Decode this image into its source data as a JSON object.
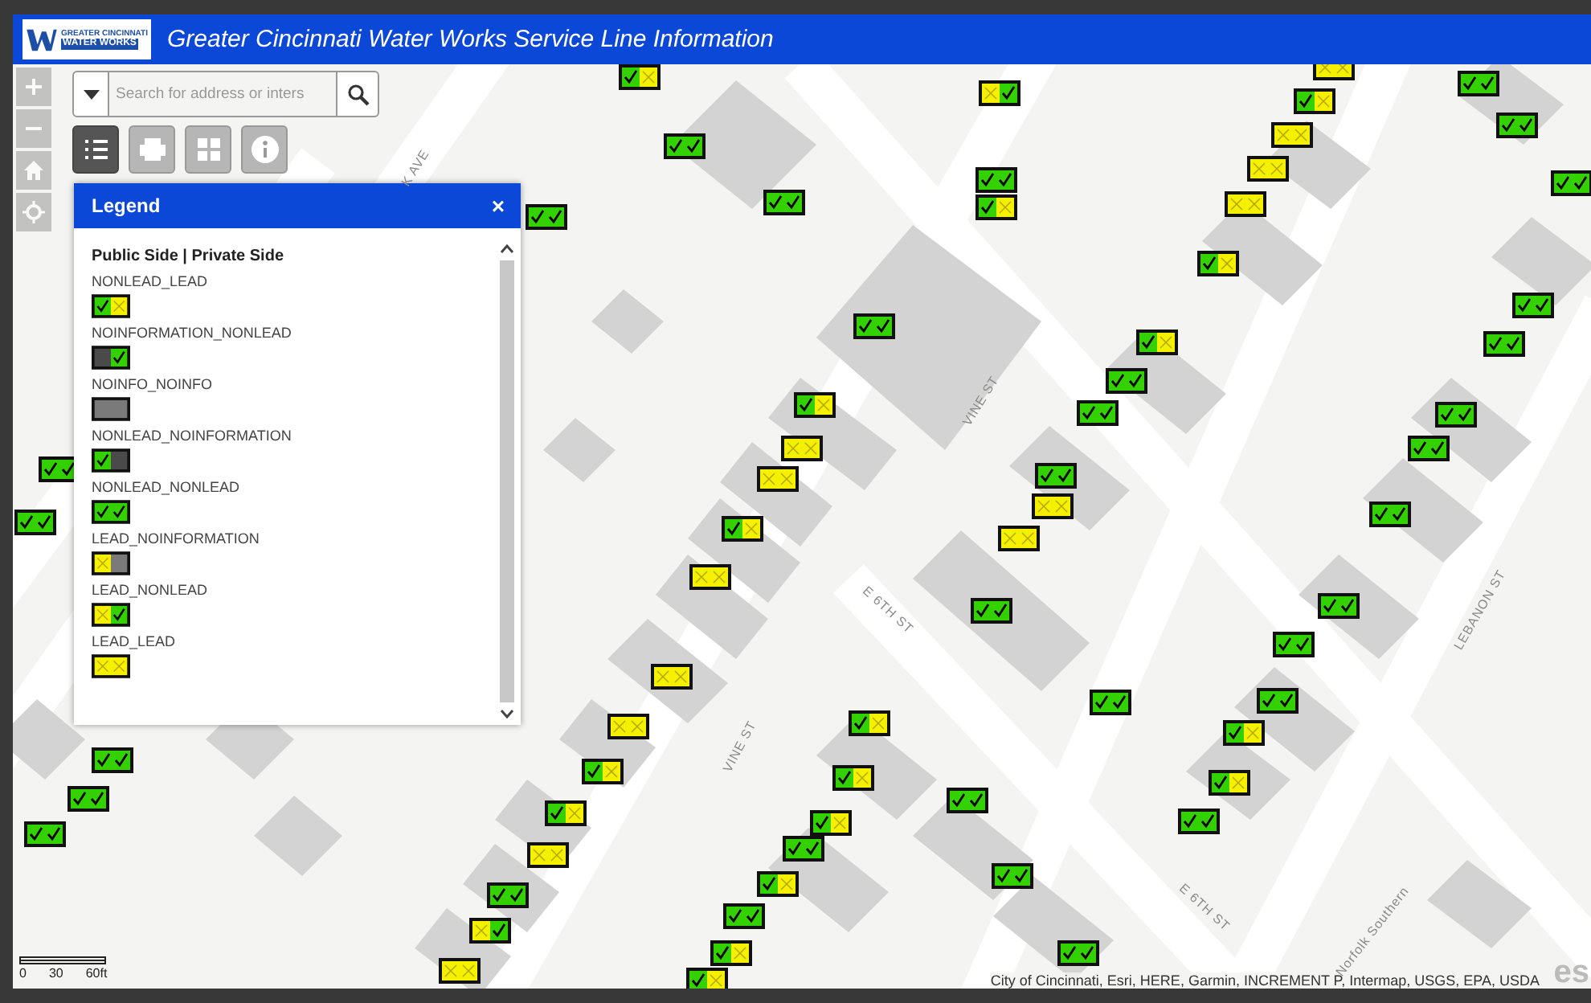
{
  "header": {
    "logo": {
      "line_1": "GREATER CINCINNATI",
      "line_2": "WATER WORKS"
    },
    "title": "Greater Cincinnati Water Works Service Line Information"
  },
  "search": {
    "placeholder": "Search for address or inters"
  },
  "toolbar": [
    {
      "kind": "legend",
      "selected": true
    },
    {
      "kind": "print",
      "selected": false
    },
    {
      "kind": "basemap",
      "selected": false
    },
    {
      "kind": "info",
      "selected": false
    }
  ],
  "legend": {
    "title": "Legend",
    "close": "×",
    "heading": "Public Side | Private Side",
    "items": [
      {
        "label": "NONLEAD_LEAD",
        "sides": [
          {
            "kind": "nonlead"
          },
          {
            "kind": "lead"
          }
        ]
      },
      {
        "label": "NOINFORMATION_NONLEAD",
        "sides": [
          {
            "kind": "noinfodark"
          },
          {
            "kind": "nonlead"
          }
        ]
      },
      {
        "label": "NOINFO_NOINFO",
        "sides": [
          {
            "kind": "noinfo"
          },
          {
            "kind": "noinfo"
          }
        ]
      },
      {
        "label": "NONLEAD_NOINFORMATION",
        "sides": [
          {
            "kind": "nonlead"
          },
          {
            "kind": "noinfodark"
          }
        ]
      },
      {
        "label": "NONLEAD_NONLEAD",
        "sides": [
          {
            "kind": "nonlead"
          },
          {
            "kind": "nonlead"
          }
        ]
      },
      {
        "label": "LEAD_NOINFORMATION",
        "sides": [
          {
            "kind": "lead"
          },
          {
            "kind": "noinfo"
          }
        ]
      },
      {
        "label": "LEAD_NONLEAD",
        "sides": [
          {
            "kind": "lead"
          },
          {
            "kind": "nonlead"
          }
        ]
      },
      {
        "label": "LEAD_LEAD",
        "sides": [
          {
            "kind": "lead"
          },
          {
            "kind": "lead"
          }
        ]
      }
    ]
  },
  "streets": [
    "K AVE",
    "VINE ST",
    "E 6TH ST",
    "VINE ST",
    "E 6TH ST",
    "LEBANON ST",
    "Norfolk Southern"
  ],
  "markers": [
    {
      "sides": [
        {
          "kind": "nonlead"
        },
        {
          "kind": "lead"
        }
      ]
    },
    {
      "sides": [
        {
          "kind": "nonlead"
        },
        {
          "kind": "nonlead"
        }
      ]
    },
    {
      "sides": [
        {
          "kind": "nonlead"
        },
        {
          "kind": "nonlead"
        }
      ]
    },
    {
      "sides": [
        {
          "kind": "nonlead"
        },
        {
          "kind": "nonlead"
        }
      ]
    },
    {
      "sides": [
        {
          "kind": "lead"
        },
        {
          "kind": "nonlead"
        }
      ]
    },
    {
      "sides": [
        {
          "kind": "nonlead"
        },
        {
          "kind": "nonlead"
        }
      ]
    },
    {
      "sides": [
        {
          "kind": "nonlead"
        },
        {
          "kind": "lead"
        }
      ]
    },
    {
      "sides": [
        {
          "kind": "nonlead"
        },
        {
          "kind": "nonlead"
        }
      ]
    },
    {
      "sides": [
        {
          "kind": "nonlead"
        },
        {
          "kind": "lead"
        }
      ]
    },
    {
      "sides": [
        {
          "kind": "lead"
        },
        {
          "kind": "lead"
        }
      ]
    },
    {
      "sides": [
        {
          "kind": "lead"
        },
        {
          "kind": "lead"
        }
      ]
    },
    {
      "sides": [
        {
          "kind": "nonlead"
        },
        {
          "kind": "lead"
        }
      ]
    },
    {
      "sides": [
        {
          "kind": "lead"
        },
        {
          "kind": "lead"
        }
      ]
    },
    {
      "sides": [
        {
          "kind": "lead"
        },
        {
          "kind": "lead"
        }
      ]
    },
    {
      "sides": [
        {
          "kind": "lead"
        },
        {
          "kind": "lead"
        }
      ]
    },
    {
      "sides": [
        {
          "kind": "nonlead"
        },
        {
          "kind": "lead"
        }
      ]
    },
    {
      "sides": [
        {
          "kind": "nonlead"
        },
        {
          "kind": "lead"
        }
      ]
    },
    {
      "sides": [
        {
          "kind": "lead"
        },
        {
          "kind": "lead"
        }
      ]
    },
    {
      "sides": [
        {
          "kind": "nonlead"
        },
        {
          "kind": "nonlead"
        }
      ]
    },
    {
      "sides": [
        {
          "kind": "lead"
        },
        {
          "kind": "nonlead"
        }
      ]
    },
    {
      "sides": [
        {
          "kind": "lead"
        },
        {
          "kind": "lead"
        }
      ]
    },
    {
      "sides": [
        {
          "kind": "nonlead"
        },
        {
          "kind": "lead"
        }
      ]
    },
    {
      "sides": [
        {
          "kind": "nonlead"
        },
        {
          "kind": "lead"
        }
      ]
    },
    {
      "sides": [
        {
          "kind": "nonlead"
        },
        {
          "kind": "lead"
        }
      ]
    },
    {
      "sides": [
        {
          "kind": "nonlead"
        },
        {
          "kind": "nonlead"
        }
      ]
    },
    {
      "sides": [
        {
          "kind": "nonlead"
        },
        {
          "kind": "lead"
        }
      ]
    },
    {
      "sides": [
        {
          "kind": "nonlead"
        },
        {
          "kind": "nonlead"
        }
      ]
    },
    {
      "sides": [
        {
          "kind": "nonlead"
        },
        {
          "kind": "lead"
        }
      ]
    },
    {
      "sides": [
        {
          "kind": "nonlead"
        },
        {
          "kind": "lead"
        }
      ]
    },
    {
      "sides": [
        {
          "kind": "nonlead"
        },
        {
          "kind": "nonlead"
        }
      ]
    },
    {
      "sides": [
        {
          "kind": "nonlead"
        },
        {
          "kind": "nonlead"
        }
      ]
    },
    {
      "sides": [
        {
          "kind": "nonlead"
        },
        {
          "kind": "nonlead"
        }
      ]
    },
    {
      "sides": [
        {
          "kind": "nonlead"
        },
        {
          "kind": "nonlead"
        }
      ]
    },
    {
      "sides": [
        {
          "kind": "lead"
        },
        {
          "kind": "lead"
        }
      ]
    },
    {
      "sides": [
        {
          "kind": "lead"
        },
        {
          "kind": "lead"
        }
      ]
    },
    {
      "sides": [
        {
          "kind": "nonlead"
        },
        {
          "kind": "nonlead"
        }
      ]
    },
    {
      "sides": [
        {
          "kind": "nonlead"
        },
        {
          "kind": "nonlead"
        }
      ]
    },
    {
      "sides": [
        {
          "kind": "nonlead"
        },
        {
          "kind": "nonlead"
        }
      ]
    },
    {
      "sides": [
        {
          "kind": "nonlead"
        },
        {
          "kind": "lead"
        }
      ]
    },
    {
      "sides": [
        {
          "kind": "nonlead"
        },
        {
          "kind": "lead"
        }
      ]
    },
    {
      "sides": [
        {
          "kind": "lead"
        },
        {
          "kind": "lead"
        }
      ]
    },
    {
      "sides": [
        {
          "kind": "lead"
        },
        {
          "kind": "lead"
        }
      ]
    },
    {
      "sides": [
        {
          "kind": "lead"
        },
        {
          "kind": "lead"
        }
      ]
    },
    {
      "sides": [
        {
          "kind": "nonlead"
        },
        {
          "kind": "lead"
        }
      ]
    },
    {
      "sides": [
        {
          "kind": "lead"
        },
        {
          "kind": "lead"
        }
      ]
    },
    {
      "sides": [
        {
          "kind": "nonlead"
        },
        {
          "kind": "nonlead"
        }
      ]
    },
    {
      "sides": [
        {
          "kind": "nonlead"
        },
        {
          "kind": "nonlead"
        }
      ]
    },
    {
      "sides": [
        {
          "kind": "nonlead"
        },
        {
          "kind": "nonlead"
        }
      ]
    },
    {
      "sides": [
        {
          "kind": "nonlead"
        },
        {
          "kind": "nonlead"
        }
      ]
    },
    {
      "sides": [
        {
          "kind": "nonlead"
        },
        {
          "kind": "nonlead"
        }
      ]
    },
    {
      "sides": [
        {
          "kind": "nonlead"
        },
        {
          "kind": "nonlead"
        }
      ]
    },
    {
      "sides": [
        {
          "kind": "nonlead"
        },
        {
          "kind": "nonlead"
        }
      ]
    },
    {
      "sides": [
        {
          "kind": "nonlead"
        },
        {
          "kind": "nonlead"
        }
      ]
    },
    {
      "sides": [
        {
          "kind": "nonlead"
        },
        {
          "kind": "nonlead"
        }
      ]
    },
    {
      "sides": [
        {
          "kind": "nonlead"
        },
        {
          "kind": "nonlead"
        }
      ]
    },
    {
      "sides": [
        {
          "kind": "nonlead"
        },
        {
          "kind": "nonlead"
        }
      ]
    },
    {
      "sides": [
        {
          "kind": "nonlead"
        },
        {
          "kind": "lead"
        }
      ]
    },
    {
      "sides": [
        {
          "kind": "nonlead"
        },
        {
          "kind": "lead"
        }
      ]
    },
    {
      "sides": [
        {
          "kind": "nonlead"
        },
        {
          "kind": "nonlead"
        }
      ]
    },
    {
      "sides": [
        {
          "kind": "nonlead"
        },
        {
          "kind": "nonlead"
        }
      ]
    },
    {
      "sides": [
        {
          "kind": "nonlead"
        },
        {
          "kind": "nonlead"
        }
      ]
    },
    {
      "sides": [
        {
          "kind": "nonlead"
        },
        {
          "kind": "nonlead"
        }
      ]
    },
    {
      "sides": [
        {
          "kind": "nonlead"
        },
        {
          "kind": "nonlead"
        }
      ]
    },
    {
      "sides": [
        {
          "kind": "nonlead"
        },
        {
          "kind": "nonlead"
        }
      ]
    },
    {
      "sides": [
        {
          "kind": "nonlead"
        },
        {
          "kind": "nonlead"
        }
      ]
    }
  ],
  "scale_bar": {
    "labels": [
      "0",
      "30",
      "60ft"
    ]
  },
  "attribution": "City of Cincinnati, Esri, HERE, Garmin, INCREMENT P, Intermap, USGS, EPA, USDA",
  "esri_logo": "es"
}
